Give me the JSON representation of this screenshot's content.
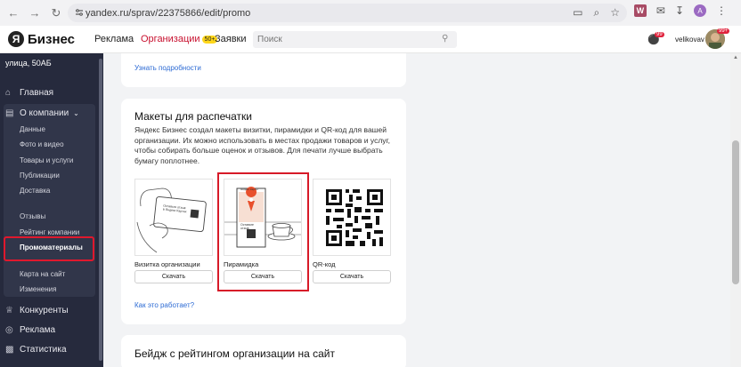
{
  "browser": {
    "url": "yandex.ru/sprav/22375866/edit/promo",
    "ext_badge": "W",
    "profile_initial": "A"
  },
  "header": {
    "logo_text": "Бизнес",
    "logo_letter": "Я",
    "nav": [
      {
        "label": "Реклама"
      },
      {
        "label": "Организации",
        "badge": "50+"
      },
      {
        "label": "Заявки"
      }
    ],
    "search_placeholder": "Поиск",
    "notifications_count": "99",
    "username": "velikovav",
    "avatar_count": "99+"
  },
  "sidebar": {
    "address": "улица, 50АБ",
    "main_items": [
      {
        "label": "Главная",
        "icon": "home-icon"
      },
      {
        "label": "О компании",
        "icon": "document-icon",
        "expanded": true
      }
    ],
    "sub_items": [
      {
        "label": "Данные"
      },
      {
        "label": "Фото и видео"
      },
      {
        "label": "Товары и услуги"
      },
      {
        "label": "Публикации"
      },
      {
        "label": "Доставка"
      },
      {
        "label": "Отзывы"
      },
      {
        "label": "Рейтинг компании"
      },
      {
        "label": "Промоматериалы",
        "active": true
      },
      {
        "label": "Карта на сайт"
      },
      {
        "label": "Изменения"
      }
    ],
    "bottom_items": [
      {
        "label": "Конкуренты",
        "icon": "trophy-icon"
      },
      {
        "label": "Реклама",
        "icon": "megaphone-icon"
      },
      {
        "label": "Статистика",
        "icon": "chart-icon"
      }
    ]
  },
  "cards": {
    "top_link": "Узнать подробности",
    "print": {
      "title": "Макеты для распечатки",
      "description": "Яндекс Бизнес создал макеты визитки, пирамидки и QR-код для вашей организации. Их можно использовать в местах продажи товаров и услуг, чтобы собирать больше оценок и отзывов. Для печати лучше выбрать бумагу поплотнее.",
      "tiles": [
        {
          "label": "Визитка организации",
          "button": "Скачать",
          "card_text": "Оставьте отзыв в Яндекс Картах"
        },
        {
          "label": "Пирамидка",
          "button": "Скачать",
          "card_text": "Оставьте отзыв",
          "card_brand": "Яндекс Карты"
        },
        {
          "label": "QR-код",
          "button": "Скачать"
        }
      ],
      "how_link": "Как это работает?"
    },
    "badge_title": "Бейдж с рейтингом организации на сайт"
  },
  "colors": {
    "accent_red": "#d71a28",
    "link_blue": "#2d6bd4",
    "sidebar_bg": "#262a3d",
    "org_red": "#c8102e"
  }
}
